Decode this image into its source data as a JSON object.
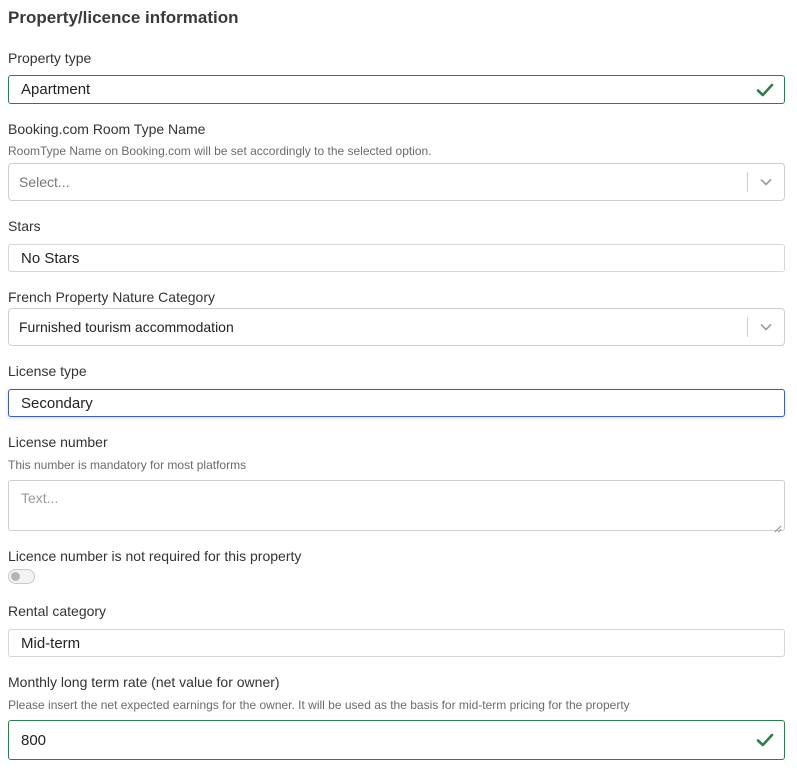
{
  "section": {
    "title": "Property/licence information"
  },
  "property_type": {
    "label": "Property type",
    "value": "Apartment",
    "status_icon": "check-icon"
  },
  "booking_room_type": {
    "label": "Booking.com Room Type Name",
    "hint": "RoomType Name on Booking.com will be set accordingly to the selected option.",
    "placeholder": "Select..."
  },
  "stars": {
    "label": "Stars",
    "value": "No Stars"
  },
  "french_nature": {
    "label": "French Property Nature Category",
    "value": "Furnished tourism accommodation"
  },
  "license_type": {
    "label": "License type",
    "value": "Secondary"
  },
  "license_number": {
    "label": "License number",
    "hint": "This number is mandatory for most platforms",
    "placeholder": "Text..."
  },
  "licence_not_required": {
    "label": "Licence number is not required for this property",
    "checked": false
  },
  "rental_category": {
    "label": "Rental category",
    "value": "Mid-term"
  },
  "monthly_rate": {
    "label": "Monthly long term rate (net value for owner)",
    "hint": "Please insert the net expected earnings for the owner. It will be used as the basis for mid-term pricing for the property",
    "value": "800",
    "status_icon": "check-icon"
  },
  "colors": {
    "valid": "#2e7d4f",
    "focus": "#3f5fa8",
    "border": "#d6d6d6"
  }
}
